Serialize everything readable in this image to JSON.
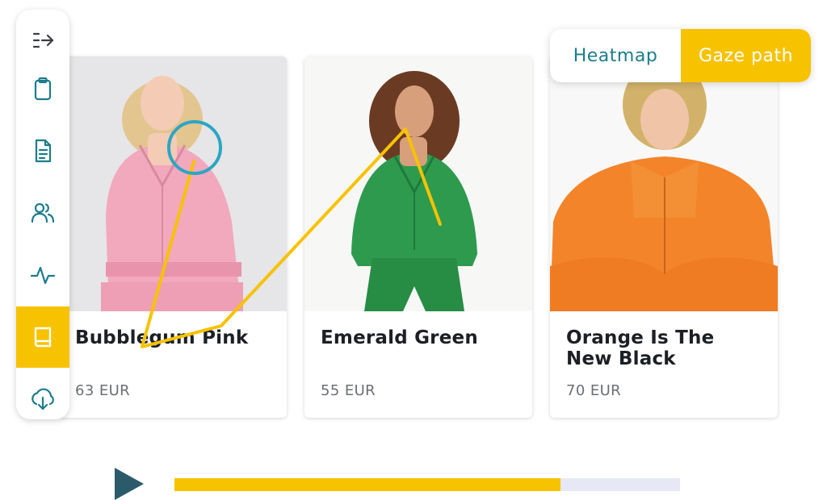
{
  "sidebar": {
    "items": [
      {
        "icon": "collapse-arrow-icon",
        "active": false
      },
      {
        "icon": "clipboard-icon",
        "active": false
      },
      {
        "icon": "document-icon",
        "active": false
      },
      {
        "icon": "users-icon",
        "active": false
      },
      {
        "icon": "activity-icon",
        "active": false
      },
      {
        "icon": "book-icon",
        "active": true
      },
      {
        "icon": "cloud-download-icon",
        "active": false
      }
    ]
  },
  "view_toggle": {
    "options": [
      "Heatmap",
      "Gaze path"
    ],
    "selected": "Gaze path"
  },
  "products": [
    {
      "name": "Bubblegum Pink",
      "price": "63 EUR",
      "image": "woman in pink tracksuit"
    },
    {
      "name": "Emerald Green",
      "price": "55 EUR",
      "image": "woman in green tracksuit"
    },
    {
      "name": "Orange Is The New Black",
      "price": "70 EUR",
      "image": "woman in orange tracksuit"
    }
  ],
  "player": {
    "progress": 0.763
  },
  "colors": {
    "accent": "#f7c200",
    "teal": "#1d7c8c",
    "play": "#2b5a6b",
    "track": "#e6e9f5",
    "fixation": "#2aa6c4"
  }
}
